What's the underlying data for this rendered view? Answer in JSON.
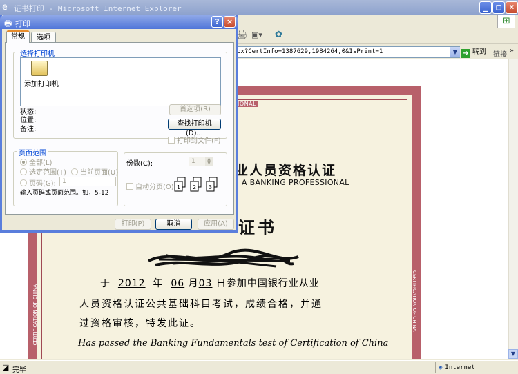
{
  "browser": {
    "title": "证书打印 - Microsoft Internet Explorer",
    "address_value": "px?CertInfo=1387629,1984264,0&IsPrint=1",
    "go_label": "转到",
    "links_label": "链接",
    "status_text": "完毕",
    "zone_text": "Internet"
  },
  "dialog": {
    "title": "打印",
    "tabs": [
      "常规",
      "选项"
    ],
    "printer_group": "选择打印机",
    "add_printer": "添加打印机",
    "status_label": "状态:",
    "location_label": "位置:",
    "comment_label": "备注:",
    "preferences_button": "首选项(R)",
    "find_printer_button": "查找打印机(D)...",
    "print_to_file": "打印到文件(F)",
    "range_group": "页面范围",
    "range_all": "全部(L)",
    "range_selection": "选定范围(T)",
    "range_current": "当前页面(U)",
    "range_pages": "页码(G):",
    "pages_value": "1",
    "range_hint": "输入页码或页面范围。如，5-12",
    "copies_label": "份数(C):",
    "copies_value": "1",
    "collate_label": "自动分页(O)",
    "print_button": "打印(P)",
    "cancel_button": "取消",
    "apply_button": "应用(A)"
  },
  "certificate": {
    "professional_top": "PROFESSIONAL",
    "heading": "业人员资格认证",
    "subheading": "A BANKING PROFESSIONAL",
    "title": "证书",
    "line1_pre": "于",
    "year": "2012",
    "line1_year_unit": "年",
    "month": "06",
    "line1_month_unit": "月",
    "day": "03",
    "line1_post": "日参加中国银行业从业",
    "line2": "人员资格认证公共基础科目考试，成绩合格，并通",
    "line3": "过资格审核，特发此证。",
    "english": "Has passed the Banking Fundamentals test of Certification of China",
    "side_text": "CERTIFICATION OF CHINA"
  },
  "colors": {
    "border_red": "#b8606a",
    "dialog_blue": "#5a7edc",
    "paper": "#f6f2df"
  }
}
